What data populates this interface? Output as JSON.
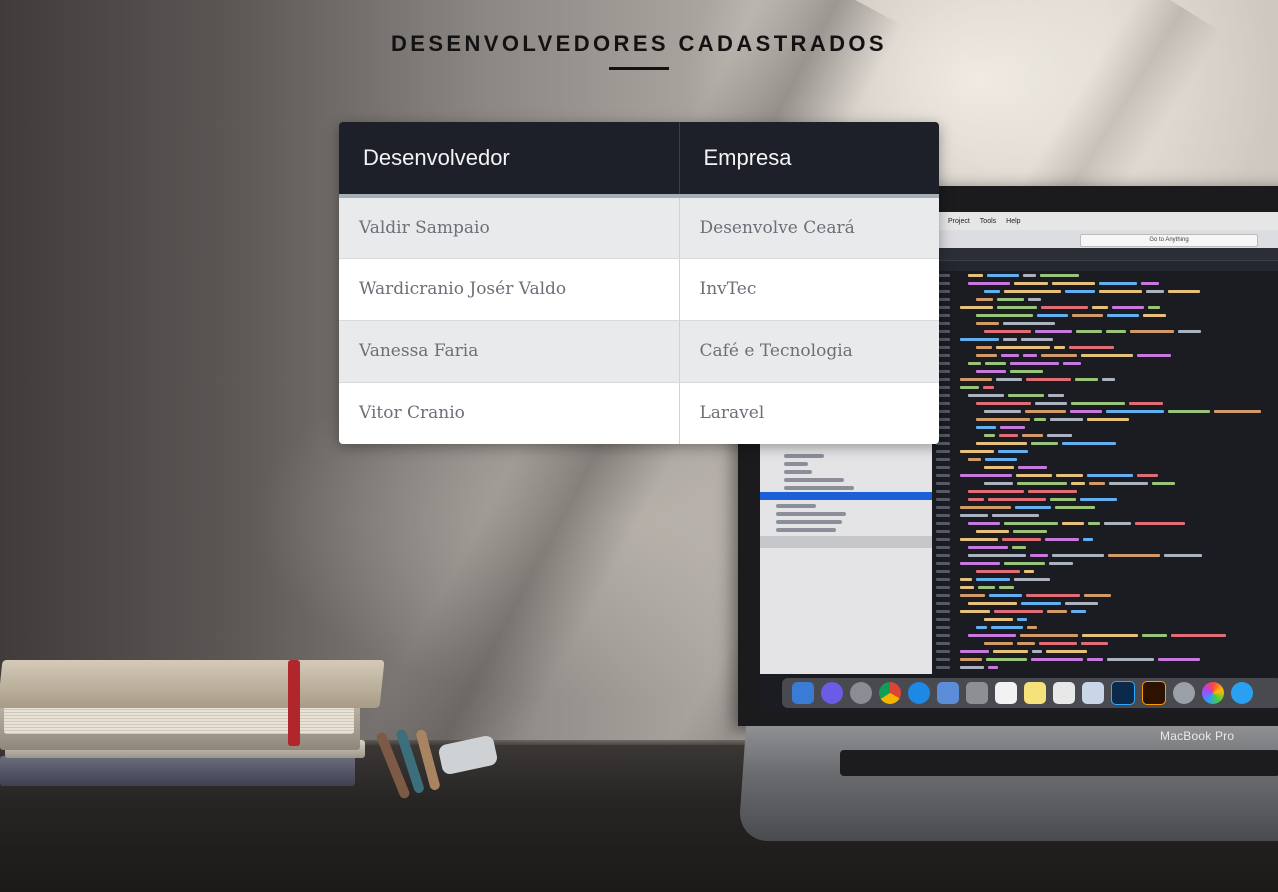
{
  "page": {
    "title": "DESENVOLVEDORES CADASTRADOS"
  },
  "table": {
    "headers": [
      "Desenvolvedor",
      "Empresa"
    ],
    "rows": [
      {
        "developer": "Valdir Sampaio",
        "company": "Desenvolve Ceará"
      },
      {
        "developer": "Wardicranio Josér Valdo",
        "company": "InvTec"
      },
      {
        "developer": "Vanessa Faria",
        "company": "Café e Tecnologia"
      },
      {
        "developer": "Vitor Cranio",
        "company": "Laravel"
      }
    ]
  },
  "background": {
    "laptop_brand": "MacBook Pro",
    "editor_menu": [
      "Project",
      "Tools",
      "Help"
    ],
    "editor_search": "Go to Anything",
    "colors": {
      "header_bg": "#1d2028",
      "row_alt_bg": "#e9eaeb",
      "accent_strap": "#b0262b"
    }
  }
}
